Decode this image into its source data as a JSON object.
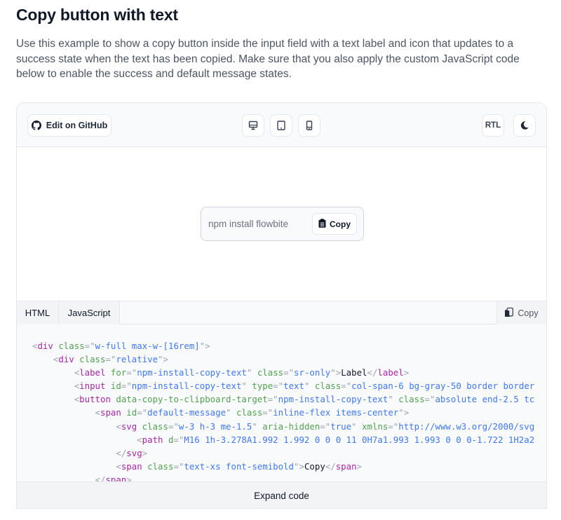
{
  "heading": {
    "title": "Copy button with text",
    "description": "Use this example to show a copy button inside the input field with a text label and icon that updates to a success state when the text has been copied. Make sure that you also apply the custom JavaScript code below to enable the success and default message states."
  },
  "toolbar": {
    "github_label": "Edit on GitHub",
    "github_icon": "github-icon",
    "view_buttons": [
      "desktop-icon",
      "tablet-icon",
      "mobile-icon"
    ],
    "rtl_label": "RTL",
    "dark_mode_icon": "moon-icon"
  },
  "preview": {
    "input_value": "npm install flowbite",
    "copy_button_label": "Copy",
    "copy_button_icon": "clipboard-icon"
  },
  "code_panel": {
    "tabs": [
      {
        "label": "HTML",
        "active": true
      },
      {
        "label": "JavaScript",
        "active": false
      }
    ],
    "copy_label": "Copy",
    "copy_icon": "copy-icon",
    "lines": [
      {
        "indent": 0,
        "parts": [
          [
            "p",
            "<"
          ],
          [
            "t",
            "div"
          ],
          [
            "a",
            " class"
          ],
          [
            "p",
            "=\""
          ],
          [
            "s",
            "w-full max-w-[16rem]"
          ],
          [
            "p",
            "\">"
          ]
        ]
      },
      {
        "indent": 1,
        "parts": [
          [
            "p",
            "<"
          ],
          [
            "t",
            "div"
          ],
          [
            "a",
            " class"
          ],
          [
            "p",
            "=\""
          ],
          [
            "s",
            "relative"
          ],
          [
            "p",
            "\">"
          ]
        ]
      },
      {
        "indent": 2,
        "parts": [
          [
            "p",
            "<"
          ],
          [
            "t",
            "label"
          ],
          [
            "a",
            " for"
          ],
          [
            "p",
            "=\""
          ],
          [
            "s",
            "npm-install-copy-text"
          ],
          [
            "p",
            "\""
          ],
          [
            "a",
            " class"
          ],
          [
            "p",
            "=\""
          ],
          [
            "s",
            "sr-only"
          ],
          [
            "p",
            "\">"
          ],
          [
            "x",
            "Label"
          ],
          [
            "p",
            "</"
          ],
          [
            "t",
            "label"
          ],
          [
            "p",
            ">"
          ]
        ]
      },
      {
        "indent": 2,
        "parts": [
          [
            "p",
            "<"
          ],
          [
            "t",
            "input"
          ],
          [
            "a",
            " id"
          ],
          [
            "p",
            "=\""
          ],
          [
            "s",
            "npm-install-copy-text"
          ],
          [
            "p",
            "\""
          ],
          [
            "a",
            " type"
          ],
          [
            "p",
            "=\""
          ],
          [
            "s",
            "text"
          ],
          [
            "p",
            "\""
          ],
          [
            "a",
            " class"
          ],
          [
            "p",
            "=\""
          ],
          [
            "s",
            "col-span-6 bg-gray-50 border border"
          ]
        ]
      },
      {
        "indent": 2,
        "parts": [
          [
            "p",
            "<"
          ],
          [
            "t",
            "button"
          ],
          [
            "a",
            " data-copy-to-clipboard-target"
          ],
          [
            "p",
            "=\""
          ],
          [
            "s",
            "npm-install-copy-text"
          ],
          [
            "p",
            "\""
          ],
          [
            "a",
            " class"
          ],
          [
            "p",
            "=\""
          ],
          [
            "s",
            "absolute end-2.5 tc"
          ]
        ]
      },
      {
        "indent": 3,
        "parts": [
          [
            "p",
            "<"
          ],
          [
            "t",
            "span"
          ],
          [
            "a",
            " id"
          ],
          [
            "p",
            "=\""
          ],
          [
            "s",
            "default-message"
          ],
          [
            "p",
            "\""
          ],
          [
            "a",
            " class"
          ],
          [
            "p",
            "=\""
          ],
          [
            "s",
            "inline-flex items-center"
          ],
          [
            "p",
            "\">"
          ]
        ]
      },
      {
        "indent": 4,
        "parts": [
          [
            "p",
            "<"
          ],
          [
            "t",
            "svg"
          ],
          [
            "a",
            " class"
          ],
          [
            "p",
            "=\""
          ],
          [
            "s",
            "w-3 h-3 me-1.5"
          ],
          [
            "p",
            "\""
          ],
          [
            "a",
            " aria-hidden"
          ],
          [
            "p",
            "=\""
          ],
          [
            "s",
            "true"
          ],
          [
            "p",
            "\""
          ],
          [
            "a",
            " xmlns"
          ],
          [
            "p",
            "=\""
          ],
          [
            "s",
            "http://www.w3.org/2000/svg"
          ]
        ]
      },
      {
        "indent": 5,
        "parts": [
          [
            "p",
            "<"
          ],
          [
            "t",
            "path"
          ],
          [
            "a",
            " d"
          ],
          [
            "p",
            "=\""
          ],
          [
            "s",
            "M16 1h-3.278A1.992 1.992 0 0 0 11 0H7a1.993 1.993 0 0 0-1.722 1H2a2"
          ]
        ]
      },
      {
        "indent": 4,
        "parts": [
          [
            "p",
            "</"
          ],
          [
            "t",
            "svg"
          ],
          [
            "p",
            ">"
          ]
        ]
      },
      {
        "indent": 4,
        "parts": [
          [
            "p",
            "<"
          ],
          [
            "t",
            "span"
          ],
          [
            "a",
            " class"
          ],
          [
            "p",
            "=\""
          ],
          [
            "s",
            "text-xs font-semibold"
          ],
          [
            "p",
            "\">"
          ],
          [
            "x",
            "Copy"
          ],
          [
            "p",
            "</"
          ],
          [
            "t",
            "span"
          ],
          [
            "p",
            ">"
          ]
        ]
      },
      {
        "indent": 3,
        "parts": [
          [
            "p",
            "</"
          ],
          [
            "t",
            "span"
          ],
          [
            "p",
            ">"
          ]
        ]
      }
    ],
    "expand_label": "Expand code"
  }
}
